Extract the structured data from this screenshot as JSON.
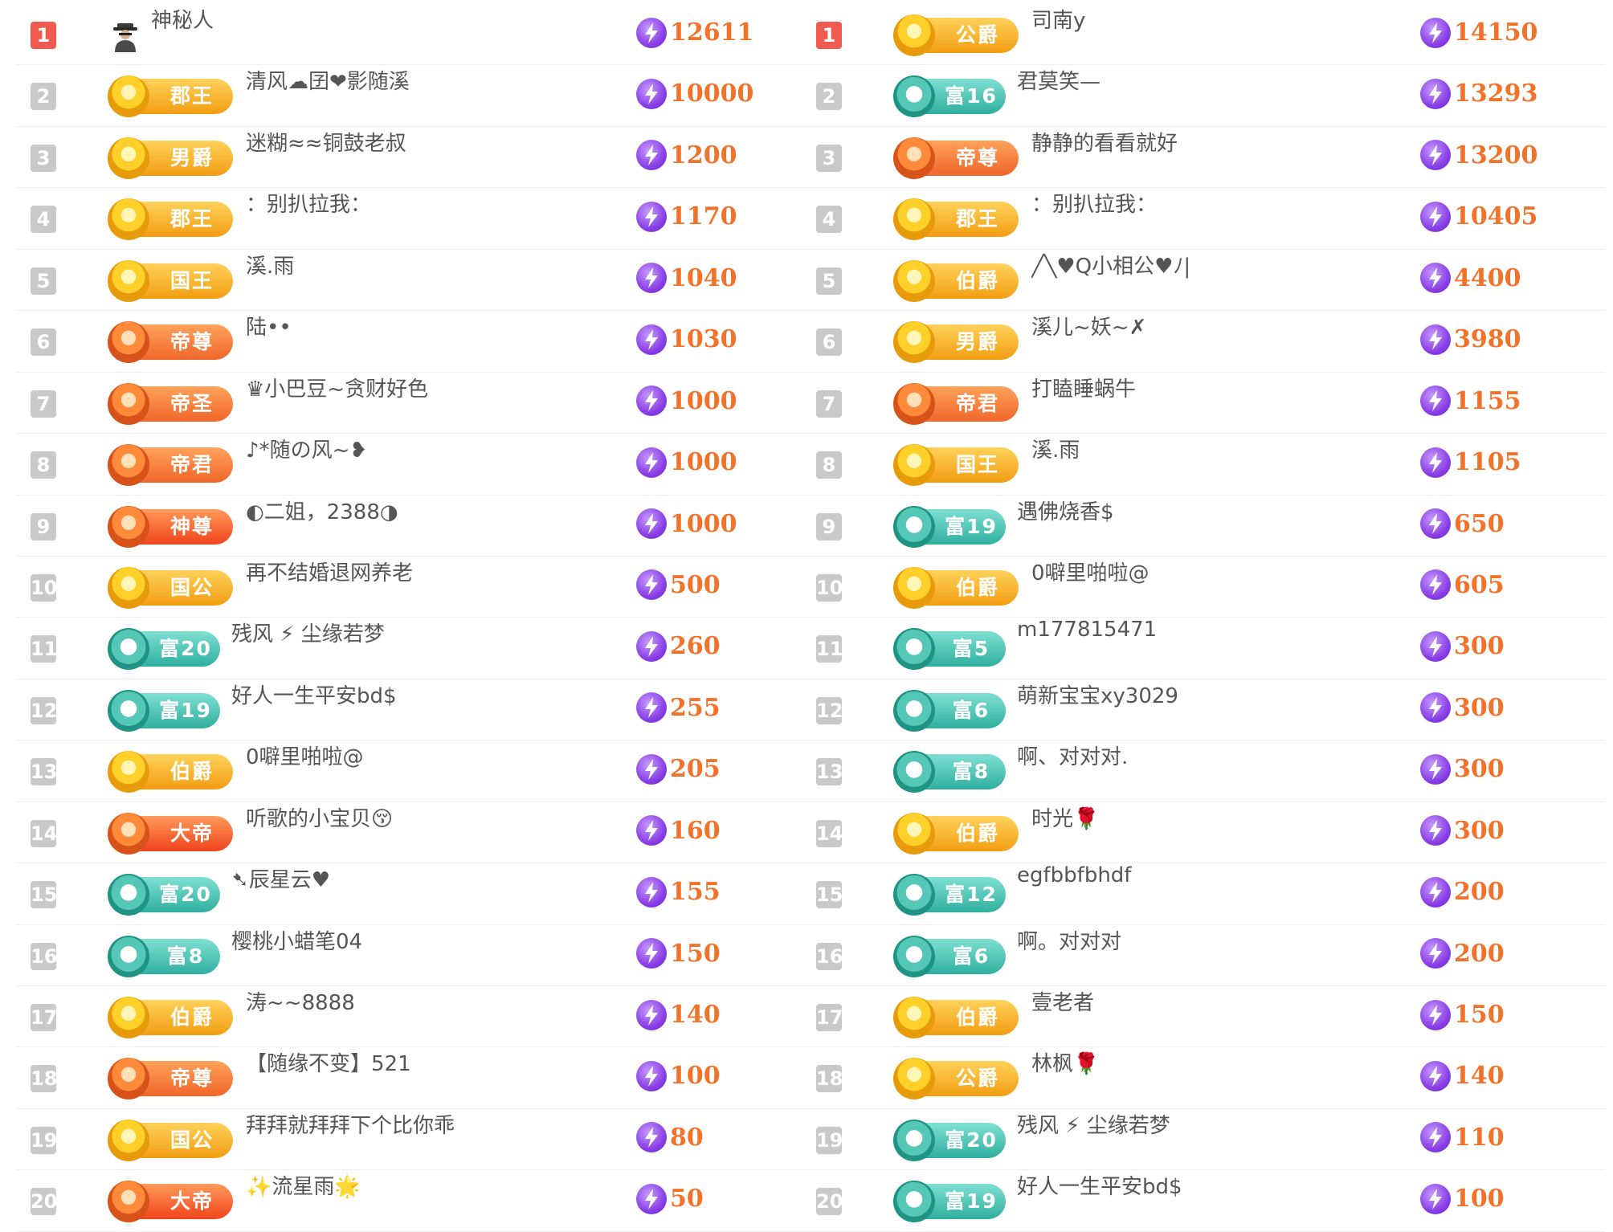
{
  "left_board": [
    {
      "rank": "1",
      "badge": "",
      "name": "神秘人",
      "score": "12611"
    },
    {
      "rank": "2",
      "badge": "郡王",
      "badge_style": "gold",
      "name": "清风☁囝❤影随溪",
      "score": "10000"
    },
    {
      "rank": "3",
      "badge": "男爵",
      "badge_style": "gold",
      "name": "迷糊≈≈铜鼓老叔",
      "score": "1200"
    },
    {
      "rank": "4",
      "badge": "郡王",
      "badge_style": "gold",
      "name": "：别扒拉我：",
      "score": "1170"
    },
    {
      "rank": "5",
      "badge": "国王",
      "badge_style": "gold",
      "name": "溪.雨",
      "score": "1040"
    },
    {
      "rank": "6",
      "badge": "帝尊",
      "badge_style": "orange",
      "name": "陆••",
      "score": "1030"
    },
    {
      "rank": "7",
      "badge": "帝圣",
      "badge_style": "orange",
      "name": "♛小巴豆~贪财好色",
      "score": "1000"
    },
    {
      "rank": "8",
      "badge": "帝君",
      "badge_style": "orange",
      "name": "♪*随の风~❥",
      "score": "1000"
    },
    {
      "rank": "9",
      "badge": "神尊",
      "badge_style": "red",
      "name": "◐二姐，2388◑",
      "score": "1000"
    },
    {
      "rank": "10",
      "badge": "国公",
      "badge_style": "gold",
      "name": "再不结婚退网养老",
      "score": "500"
    },
    {
      "rank": "11",
      "badge": "富20",
      "badge_style": "teal",
      "name": "残风 ⚡ 尘缘若梦",
      "score": "260"
    },
    {
      "rank": "12",
      "badge": "富19",
      "badge_style": "teal",
      "name": "好人一生平安bd$",
      "score": "255"
    },
    {
      "rank": "13",
      "badge": "伯爵",
      "badge_style": "gold",
      "name": "0噼里啪啦@",
      "score": "205"
    },
    {
      "rank": "14",
      "badge": "大帝",
      "badge_style": "red",
      "name": "听歌的小宝贝😚",
      "score": "160"
    },
    {
      "rank": "15",
      "badge": "富20",
      "badge_style": "teal",
      "name": "➷辰星云♥",
      "score": "155"
    },
    {
      "rank": "16",
      "badge": "富8",
      "badge_style": "teal",
      "name": "樱桃小蜡笔04",
      "score": "150"
    },
    {
      "rank": "17",
      "badge": "伯爵",
      "badge_style": "gold",
      "name": "涛~~8888",
      "score": "140"
    },
    {
      "rank": "18",
      "badge": "帝尊",
      "badge_style": "orange",
      "name": "【随缘不变】521",
      "score": "100"
    },
    {
      "rank": "19",
      "badge": "国公",
      "badge_style": "gold",
      "name": "拜拜就拜拜下个比你乖",
      "score": "80"
    },
    {
      "rank": "20",
      "badge": "大帝",
      "badge_style": "red",
      "name": "✨流星雨🌟",
      "score": "50"
    }
  ],
  "right_board": [
    {
      "rank": "1",
      "badge": "公爵",
      "badge_style": "gold",
      "name": "司南y",
      "score": "14150"
    },
    {
      "rank": "2",
      "badge": "富16",
      "badge_style": "teal",
      "name": "君莫笑—",
      "score": "13293"
    },
    {
      "rank": "3",
      "badge": "帝尊",
      "badge_style": "orange",
      "name": "静静的看看就好",
      "score": "13200"
    },
    {
      "rank": "4",
      "badge": "郡王",
      "badge_style": "gold",
      "name": "：别扒拉我：",
      "score": "10405"
    },
    {
      "rank": "5",
      "badge": "伯爵",
      "badge_style": "gold",
      "name": "╱╲♥Q小相公♥ﾉ|",
      "score": "4400"
    },
    {
      "rank": "6",
      "badge": "男爵",
      "badge_style": "gold",
      "name": "溪儿~妖~✗",
      "score": "3980"
    },
    {
      "rank": "7",
      "badge": "帝君",
      "badge_style": "orange",
      "name": "打瞌睡蜗牛",
      "score": "1155"
    },
    {
      "rank": "8",
      "badge": "国王",
      "badge_style": "gold",
      "name": "溪.雨",
      "score": "1105"
    },
    {
      "rank": "9",
      "badge": "富19",
      "badge_style": "teal",
      "name": "遇佛烧香$",
      "score": "650"
    },
    {
      "rank": "10",
      "badge": "伯爵",
      "badge_style": "gold",
      "name": "0噼里啪啦@",
      "score": "605"
    },
    {
      "rank": "11",
      "badge": "富5",
      "badge_style": "teal",
      "name": "m177815471",
      "score": "300"
    },
    {
      "rank": "12",
      "badge": "富6",
      "badge_style": "teal",
      "name": "萌新宝宝xy3029",
      "score": "300"
    },
    {
      "rank": "13",
      "badge": "富8",
      "badge_style": "teal",
      "name": "啊、对对对.",
      "score": "300"
    },
    {
      "rank": "14",
      "badge": "伯爵",
      "badge_style": "gold",
      "name": "时光🌹",
      "score": "300"
    },
    {
      "rank": "15",
      "badge": "富12",
      "badge_style": "teal",
      "name": "egfbbfbhdf",
      "score": "200"
    },
    {
      "rank": "16",
      "badge": "富6",
      "badge_style": "teal",
      "name": "啊。对对对",
      "score": "200"
    },
    {
      "rank": "17",
      "badge": "伯爵",
      "badge_style": "gold",
      "name": "壹老者",
      "score": "150"
    },
    {
      "rank": "18",
      "badge": "公爵",
      "badge_style": "gold",
      "name": "林枫🌹",
      "score": "140"
    },
    {
      "rank": "19",
      "badge": "富20",
      "badge_style": "teal",
      "name": "残风 ⚡ 尘缘若梦",
      "score": "110"
    },
    {
      "rank": "20",
      "badge": "富19",
      "badge_style": "teal",
      "name": "好人一生平安bd$",
      "score": "100"
    }
  ],
  "icons": {
    "score": "lightning-bolt-icon",
    "anonymous": "mystery-person-icon",
    "badge": "medal-icon"
  },
  "colors": {
    "score_text": "#f2722a",
    "rank_top": "#f05a4f",
    "rank_other": "#c9c9c9",
    "badge_gold": "#f5a623",
    "badge_teal": "#3bb8a8",
    "badge_orange": "#f07a32",
    "bolt": "#8a3fe6"
  }
}
